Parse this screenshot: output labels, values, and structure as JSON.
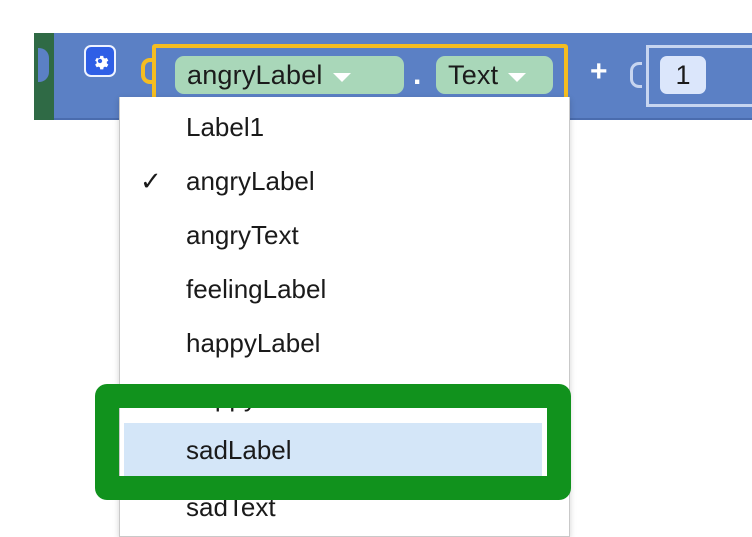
{
  "block": {
    "component_selected": "angryLabel",
    "separator": ".",
    "property_selected": "Text",
    "operator": "+",
    "number_value": "1"
  },
  "dropdown": {
    "items": [
      {
        "label": "Label1",
        "checked": false
      },
      {
        "label": "angryLabel",
        "checked": true
      },
      {
        "label": "angryText",
        "checked": false
      },
      {
        "label": "feelingLabel",
        "checked": false
      },
      {
        "label": "happyLabel",
        "checked": false
      },
      {
        "label": "happyText",
        "checked": false
      },
      {
        "label": "sadLabel",
        "checked": false,
        "highlighted": true
      },
      {
        "label": "sadText",
        "checked": false
      }
    ],
    "check_glyph": "✓"
  },
  "colors": {
    "block_blue": "#5b80c5",
    "getter_outline": "#f5bd21",
    "pill_green": "#a9d7b9",
    "highlight_green": "#11921d",
    "selection_blue": "#d4e6f8"
  },
  "icons": {
    "mutator": "gear-icon",
    "dropdown_caret": "chevron-down-icon"
  }
}
